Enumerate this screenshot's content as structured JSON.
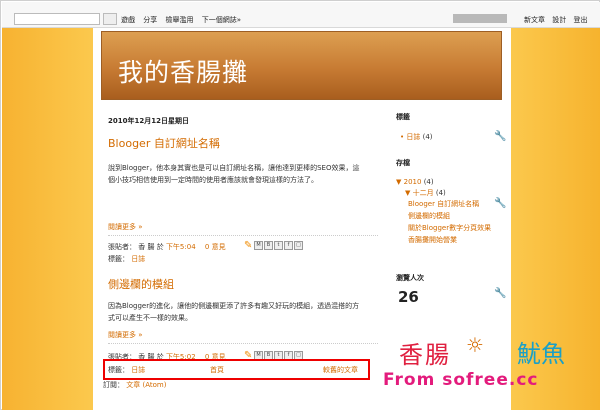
{
  "navbar": {
    "links": [
      "遊戲",
      "分享",
      "檢舉濫用",
      "下一個網誌»"
    ],
    "right_links": [
      "新文章",
      "設計",
      "登出"
    ]
  },
  "blog": {
    "title": "我的香腸攤"
  },
  "posts": [
    {
      "date": "2010年12月12日星期日",
      "title": "Blooger 自訂網址名稱",
      "body_lines": [
        "說到Blogger，他本身其實也是可以自訂網址名稱，讓他達到更棒的SEO效果，這",
        "個小技巧相信使用到一定時間的使用者應該就會發現這樣的方法了。"
      ],
      "read_more": "閱讀更多 »",
      "author_label": "張貼者：",
      "author": "香 腸",
      "at": "於",
      "time": "下午5:04",
      "comments": "0 意見",
      "label_prefix": "標籤：",
      "label": "日誌"
    },
    {
      "title": "側邊欄的模組",
      "body_lines": [
        "因為Blogger的進化，讓他的側邊欄更添了許多有趣又好玩的模組，透過混搭的方",
        "式可以產生不一樣的效果。"
      ],
      "read_more": "閱讀更多 »",
      "author_label": "張貼者：",
      "author": "香 腸",
      "at": "於",
      "time": "下午5:02",
      "comments": "0 意見",
      "label_prefix": "標籤：",
      "label": "日誌"
    }
  ],
  "share_icons": [
    "M",
    "B",
    "t",
    "f",
    "□"
  ],
  "pagination": {
    "home": "首頁",
    "older": "較舊的文章"
  },
  "subscribe": {
    "label": "訂閱：",
    "link": "文章 (Atom)"
  },
  "sidebar": {
    "labels_title": "標籤",
    "labels": [
      {
        "name": "日誌",
        "count": "(4)"
      }
    ],
    "archive_title": "存檔",
    "year": "2010",
    "year_count": "(4)",
    "month": "十二月",
    "month_count": "(4)",
    "archive_posts": [
      "Blooger 自訂網址名稱",
      "側邊欄的模組",
      "關於Blogger數字分頁效果",
      "香腸攤開始營業"
    ],
    "visitors_title": "瀏覽人次",
    "visitors_count": "26"
  },
  "watermark": {
    "title": "香腸",
    "mark": "☼",
    "fish": "魷魚",
    "site": "From sofree.cc"
  },
  "colors": {
    "accent": "#d36b00",
    "header": "#c87c34",
    "highlight": "#ee0000"
  }
}
